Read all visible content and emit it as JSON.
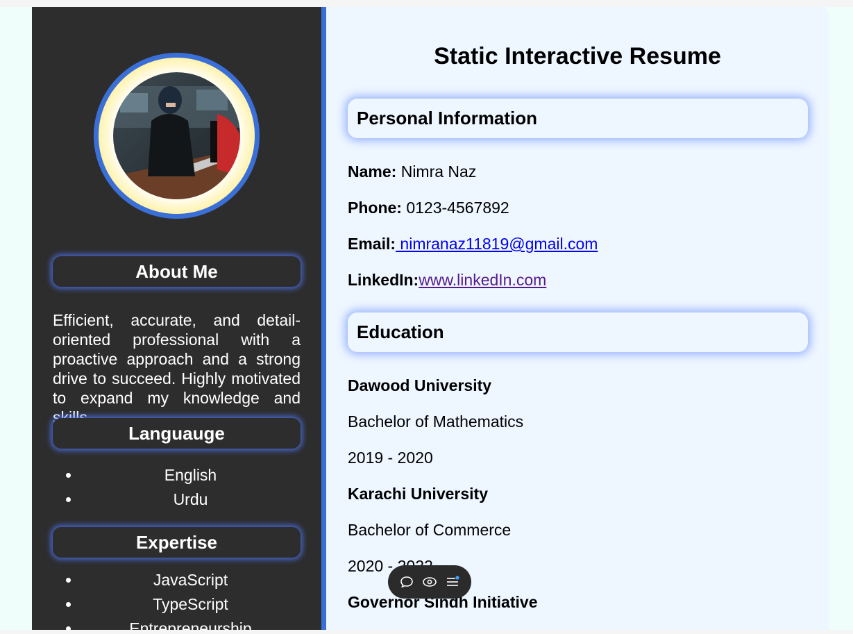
{
  "sidebar": {
    "about_heading": "About Me",
    "about_text": "Efficient, accurate, and detail-oriented professional with a proactive approach and a strong drive to succeed. Highly motivated to expand my knowledge and skills.",
    "language_heading": "Languauge",
    "languages": [
      "English",
      "Urdu"
    ],
    "expertise_heading": "Expertise",
    "expertise": [
      "JavaScript",
      "TypeScript",
      "Entrepreneurship"
    ]
  },
  "main": {
    "title": "Static Interactive Resume",
    "personal_heading": "Personal Information",
    "personal": {
      "name_label": "Name:",
      "name_value": "Nimra Naz",
      "phone_label": "Phone:",
      "phone_value": "0123-4567892",
      "email_label": "Email:",
      "email_value": " nimranaz11819@gmail.com",
      "linkedin_label": "LinkedIn:",
      "linkedin_value": "www.linkedIn.com"
    },
    "education_heading": "Education",
    "education": [
      {
        "school": "Dawood University",
        "degree": "Bachelor of Mathematics",
        "years": "2019 - 2020"
      },
      {
        "school": "Karachi University",
        "degree": "Bachelor of Commerce",
        "years": "2020 - 2022"
      },
      {
        "school": "Governor Sindh Initiative"
      }
    ]
  },
  "toolbar": {
    "icons": [
      "comment-icon",
      "eye-icon",
      "menu-icon"
    ]
  },
  "colors": {
    "sidebar_bg": "#2d2d2d",
    "accent_blue": "#3b6fd8",
    "main_bg": "#eef6ff",
    "avatar_gold": "#f7d44a"
  }
}
